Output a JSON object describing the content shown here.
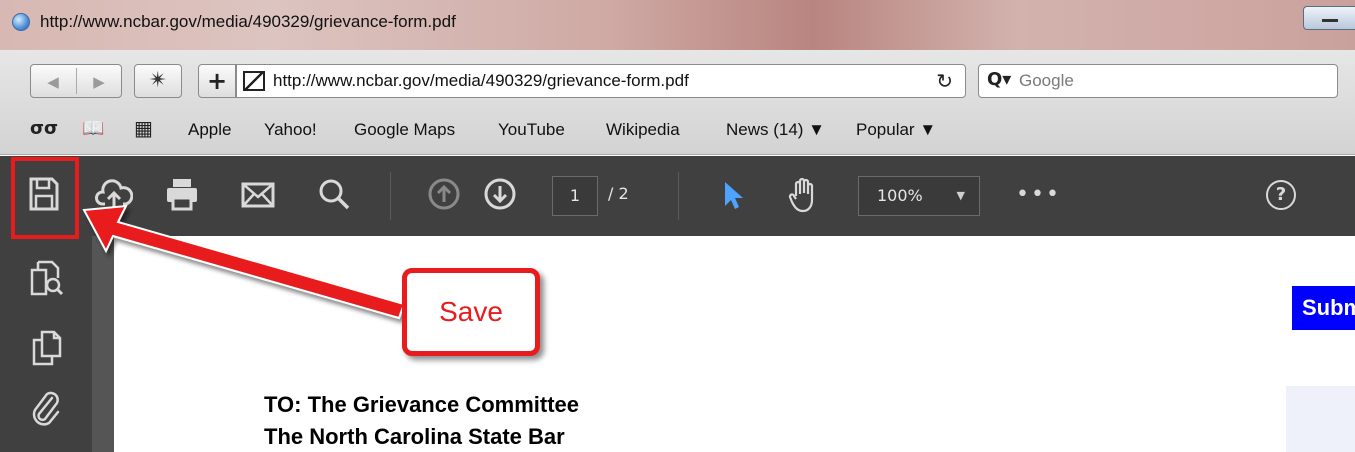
{
  "window": {
    "title": "http://www.ncbar.gov/media/490329/grievance-form.pdf"
  },
  "nav": {
    "back_icon": "back-arrow-icon",
    "forward_icon": "forward-arrow-icon",
    "add_label": "+"
  },
  "address_bar": {
    "url": "http://www.ncbar.gov/media/490329/grievance-form.pdf",
    "reload_icon": "reload-icon"
  },
  "search": {
    "placeholder": "Google",
    "icon": "search-icon"
  },
  "bookmarks": {
    "icons": [
      "reading-glasses-icon",
      "book-icon",
      "grid-icon"
    ],
    "items": [
      "Apple",
      "Yahoo!",
      "Google Maps",
      "YouTube",
      "Wikipedia",
      "News (14) ▼",
      "Popular ▼"
    ]
  },
  "pdf_toolbar": {
    "current_page": "1",
    "total_pages": "/ 2",
    "zoom": "100%",
    "more": "•••",
    "help": "?"
  },
  "document": {
    "submit_label": "Submit",
    "line1": "TO: The Grievance Committee",
    "line2": "The North Carolina State Bar"
  },
  "annotation": {
    "callout_label": "Save",
    "color": "#e81c1c"
  },
  "colors": {
    "pdf_toolbar_bg": "#404040",
    "submit_bg": "#0000ff",
    "select_tool": "#4da3ff"
  }
}
